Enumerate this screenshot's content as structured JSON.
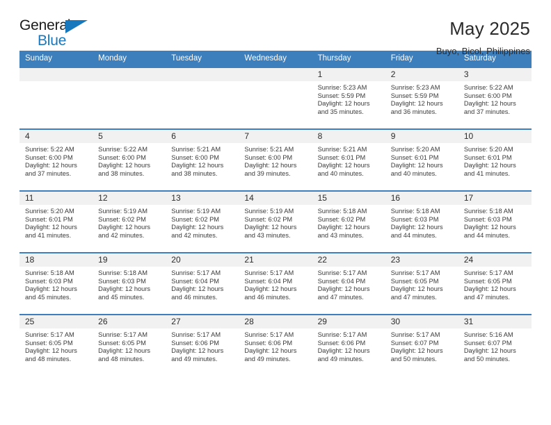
{
  "logo": {
    "word_one": "General",
    "word_two": "Blue",
    "triangle_color": "#1878be"
  },
  "header": {
    "title": "May 2025",
    "location": "Buyo, Bicol, Philippines",
    "accent_color": "#3d7ebc",
    "daynum_band_color": "#f1f1f1"
  },
  "weekdays": [
    "Sunday",
    "Monday",
    "Tuesday",
    "Wednesday",
    "Thursday",
    "Friday",
    "Saturday"
  ],
  "labels": {
    "sunrise": "Sunrise:",
    "sunset": "Sunset:",
    "daylight": "Daylight:"
  },
  "weeks": [
    [
      {
        "day": "",
        "empty": true
      },
      {
        "day": "",
        "empty": true
      },
      {
        "day": "",
        "empty": true
      },
      {
        "day": "",
        "empty": true
      },
      {
        "day": "1",
        "sunrise": "Sunrise: 5:23 AM",
        "sunset": "Sunset: 5:59 PM",
        "daylight1": "Daylight: 12 hours",
        "daylight2": "and 35 minutes."
      },
      {
        "day": "2",
        "sunrise": "Sunrise: 5:23 AM",
        "sunset": "Sunset: 5:59 PM",
        "daylight1": "Daylight: 12 hours",
        "daylight2": "and 36 minutes."
      },
      {
        "day": "3",
        "sunrise": "Sunrise: 5:22 AM",
        "sunset": "Sunset: 6:00 PM",
        "daylight1": "Daylight: 12 hours",
        "daylight2": "and 37 minutes."
      }
    ],
    [
      {
        "day": "4",
        "sunrise": "Sunrise: 5:22 AM",
        "sunset": "Sunset: 6:00 PM",
        "daylight1": "Daylight: 12 hours",
        "daylight2": "and 37 minutes."
      },
      {
        "day": "5",
        "sunrise": "Sunrise: 5:22 AM",
        "sunset": "Sunset: 6:00 PM",
        "daylight1": "Daylight: 12 hours",
        "daylight2": "and 38 minutes."
      },
      {
        "day": "6",
        "sunrise": "Sunrise: 5:21 AM",
        "sunset": "Sunset: 6:00 PM",
        "daylight1": "Daylight: 12 hours",
        "daylight2": "and 38 minutes."
      },
      {
        "day": "7",
        "sunrise": "Sunrise: 5:21 AM",
        "sunset": "Sunset: 6:00 PM",
        "daylight1": "Daylight: 12 hours",
        "daylight2": "and 39 minutes."
      },
      {
        "day": "8",
        "sunrise": "Sunrise: 5:21 AM",
        "sunset": "Sunset: 6:01 PM",
        "daylight1": "Daylight: 12 hours",
        "daylight2": "and 40 minutes."
      },
      {
        "day": "9",
        "sunrise": "Sunrise: 5:20 AM",
        "sunset": "Sunset: 6:01 PM",
        "daylight1": "Daylight: 12 hours",
        "daylight2": "and 40 minutes."
      },
      {
        "day": "10",
        "sunrise": "Sunrise: 5:20 AM",
        "sunset": "Sunset: 6:01 PM",
        "daylight1": "Daylight: 12 hours",
        "daylight2": "and 41 minutes."
      }
    ],
    [
      {
        "day": "11",
        "sunrise": "Sunrise: 5:20 AM",
        "sunset": "Sunset: 6:01 PM",
        "daylight1": "Daylight: 12 hours",
        "daylight2": "and 41 minutes."
      },
      {
        "day": "12",
        "sunrise": "Sunrise: 5:19 AM",
        "sunset": "Sunset: 6:02 PM",
        "daylight1": "Daylight: 12 hours",
        "daylight2": "and 42 minutes."
      },
      {
        "day": "13",
        "sunrise": "Sunrise: 5:19 AM",
        "sunset": "Sunset: 6:02 PM",
        "daylight1": "Daylight: 12 hours",
        "daylight2": "and 42 minutes."
      },
      {
        "day": "14",
        "sunrise": "Sunrise: 5:19 AM",
        "sunset": "Sunset: 6:02 PM",
        "daylight1": "Daylight: 12 hours",
        "daylight2": "and 43 minutes."
      },
      {
        "day": "15",
        "sunrise": "Sunrise: 5:18 AM",
        "sunset": "Sunset: 6:02 PM",
        "daylight1": "Daylight: 12 hours",
        "daylight2": "and 43 minutes."
      },
      {
        "day": "16",
        "sunrise": "Sunrise: 5:18 AM",
        "sunset": "Sunset: 6:03 PM",
        "daylight1": "Daylight: 12 hours",
        "daylight2": "and 44 minutes."
      },
      {
        "day": "17",
        "sunrise": "Sunrise: 5:18 AM",
        "sunset": "Sunset: 6:03 PM",
        "daylight1": "Daylight: 12 hours",
        "daylight2": "and 44 minutes."
      }
    ],
    [
      {
        "day": "18",
        "sunrise": "Sunrise: 5:18 AM",
        "sunset": "Sunset: 6:03 PM",
        "daylight1": "Daylight: 12 hours",
        "daylight2": "and 45 minutes."
      },
      {
        "day": "19",
        "sunrise": "Sunrise: 5:18 AM",
        "sunset": "Sunset: 6:03 PM",
        "daylight1": "Daylight: 12 hours",
        "daylight2": "and 45 minutes."
      },
      {
        "day": "20",
        "sunrise": "Sunrise: 5:17 AM",
        "sunset": "Sunset: 6:04 PM",
        "daylight1": "Daylight: 12 hours",
        "daylight2": "and 46 minutes."
      },
      {
        "day": "21",
        "sunrise": "Sunrise: 5:17 AM",
        "sunset": "Sunset: 6:04 PM",
        "daylight1": "Daylight: 12 hours",
        "daylight2": "and 46 minutes."
      },
      {
        "day": "22",
        "sunrise": "Sunrise: 5:17 AM",
        "sunset": "Sunset: 6:04 PM",
        "daylight1": "Daylight: 12 hours",
        "daylight2": "and 47 minutes."
      },
      {
        "day": "23",
        "sunrise": "Sunrise: 5:17 AM",
        "sunset": "Sunset: 6:05 PM",
        "daylight1": "Daylight: 12 hours",
        "daylight2": "and 47 minutes."
      },
      {
        "day": "24",
        "sunrise": "Sunrise: 5:17 AM",
        "sunset": "Sunset: 6:05 PM",
        "daylight1": "Daylight: 12 hours",
        "daylight2": "and 47 minutes."
      }
    ],
    [
      {
        "day": "25",
        "sunrise": "Sunrise: 5:17 AM",
        "sunset": "Sunset: 6:05 PM",
        "daylight1": "Daylight: 12 hours",
        "daylight2": "and 48 minutes."
      },
      {
        "day": "26",
        "sunrise": "Sunrise: 5:17 AM",
        "sunset": "Sunset: 6:05 PM",
        "daylight1": "Daylight: 12 hours",
        "daylight2": "and 48 minutes."
      },
      {
        "day": "27",
        "sunrise": "Sunrise: 5:17 AM",
        "sunset": "Sunset: 6:06 PM",
        "daylight1": "Daylight: 12 hours",
        "daylight2": "and 49 minutes."
      },
      {
        "day": "28",
        "sunrise": "Sunrise: 5:17 AM",
        "sunset": "Sunset: 6:06 PM",
        "daylight1": "Daylight: 12 hours",
        "daylight2": "and 49 minutes."
      },
      {
        "day": "29",
        "sunrise": "Sunrise: 5:17 AM",
        "sunset": "Sunset: 6:06 PM",
        "daylight1": "Daylight: 12 hours",
        "daylight2": "and 49 minutes."
      },
      {
        "day": "30",
        "sunrise": "Sunrise: 5:17 AM",
        "sunset": "Sunset: 6:07 PM",
        "daylight1": "Daylight: 12 hours",
        "daylight2": "and 50 minutes."
      },
      {
        "day": "31",
        "sunrise": "Sunrise: 5:16 AM",
        "sunset": "Sunset: 6:07 PM",
        "daylight1": "Daylight: 12 hours",
        "daylight2": "and 50 minutes."
      }
    ]
  ]
}
